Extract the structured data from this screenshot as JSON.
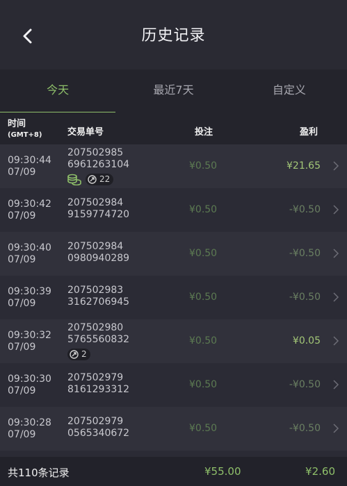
{
  "header": {
    "title": "历史记录",
    "back_icon": "chevron-left-icon"
  },
  "tabs": [
    {
      "label": "今天",
      "active": true
    },
    {
      "label": "最近7天",
      "active": false
    },
    {
      "label": "自定义",
      "active": false
    }
  ],
  "columns": {
    "time": "时间",
    "time_sub": "(GMT+8)",
    "id": "交易单号",
    "bet": "投注",
    "profit": "盈利"
  },
  "rows": [
    {
      "time": "09:30:44",
      "date": "07/09",
      "id1": "207502985",
      "id2": "6961263104",
      "bet": "¥0.50",
      "profit": "¥21.65",
      "status": "win",
      "badges": {
        "coins": true,
        "multiplier": "22"
      }
    },
    {
      "time": "09:30:42",
      "date": "07/09",
      "id1": "207502984",
      "id2": "9159774720",
      "bet": "¥0.50",
      "profit": "-¥0.50",
      "status": "loss"
    },
    {
      "time": "09:30:40",
      "date": "07/09",
      "id1": "207502984",
      "id2": "0980940289",
      "bet": "¥0.50",
      "profit": "-¥0.50",
      "status": "loss"
    },
    {
      "time": "09:30:39",
      "date": "07/09",
      "id1": "207502983",
      "id2": "3162706945",
      "bet": "¥0.50",
      "profit": "-¥0.50",
      "status": "loss"
    },
    {
      "time": "09:30:32",
      "date": "07/09",
      "id1": "207502980",
      "id2": "5765560832",
      "bet": "¥0.50",
      "profit": "¥0.05",
      "status": "win",
      "badges": {
        "coins": false,
        "multiplier": "2"
      }
    },
    {
      "time": "09:30:30",
      "date": "07/09",
      "id1": "207502979",
      "id2": "8161293312",
      "bet": "¥0.50",
      "profit": "-¥0.50",
      "status": "loss"
    },
    {
      "time": "09:30:28",
      "date": "07/09",
      "id1": "207502979",
      "id2": "0565340672",
      "bet": "¥0.50",
      "profit": "-¥0.50",
      "status": "loss"
    }
  ],
  "footer": {
    "total": "共110条记录",
    "sum_bet": "¥55.00",
    "sum_profit": "¥2.60"
  },
  "colors": {
    "accent": "#8fc06a",
    "win": "#a3c777",
    "loss": "#6a7f62",
    "bet": "#5c7a52"
  }
}
